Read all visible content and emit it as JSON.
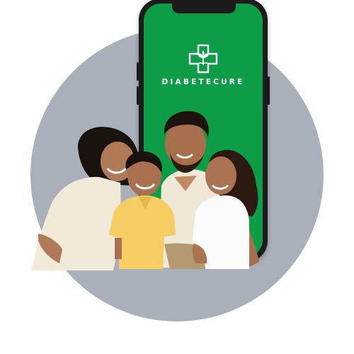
{
  "brand": {
    "name": "DIABETECURE",
    "screen_color": "#0d9d46",
    "logo": "medical-cross-leaf-icon"
  },
  "colors": {
    "backdrop": "#aab0b9",
    "phone_frame": "#1b1b1d"
  },
  "photo": {
    "subject": "family-photo"
  }
}
